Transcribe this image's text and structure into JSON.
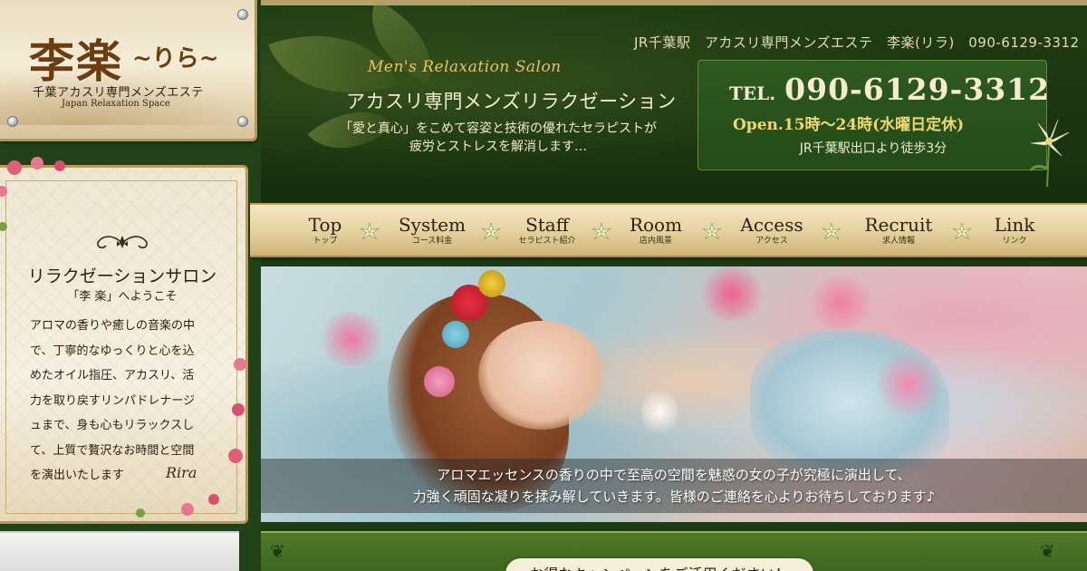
{
  "logo": {
    "main": "李楽",
    "sub": "~りら~",
    "tagline": "千葉アカスリ専門メンズエステ",
    "tagline_en": "Japan Relaxation Space"
  },
  "welcome": {
    "ornament_icon": "scroll-ornament-icon",
    "title": "リラクゼーションサロン",
    "subtitle": "「李 楽」へようこそ",
    "body": "アロマの香りや癒しの音楽の中\nで、丁寧的なゆっくりと心を込\nめたオイル指圧、アカスリ、活\n力を取り戻すリンパドレナージ\nュまで、身も心もリラックスし\nて、上質で贅沢なお時間と空間\nを演出いたします",
    "signature": "Rira"
  },
  "header": {
    "top_info": "JR千葉駅　アカスリ専門メンズエステ　李楽(リラ)　090-6129-3312",
    "script_title": "Men's Relaxation Salon",
    "title": "アカスリ専門メンズリラクゼーション",
    "description": "「愛と真心」をこめて容姿と技術の優れたセラピストが\n疲労とストレスを解消します…"
  },
  "tel_box": {
    "label": "TEL.",
    "number": "090-6129-3312",
    "open_hours": "Open.15時～24時(水曜日定休)",
    "access": "JR千葉駅出口より徒歩3分"
  },
  "nav": {
    "items": [
      {
        "en": "Top",
        "jp": "トップ"
      },
      {
        "en": "System",
        "jp": "コース料金"
      },
      {
        "en": "Staff",
        "jp": "セラピスト紹介"
      },
      {
        "en": "Room",
        "jp": "店内風景"
      },
      {
        "en": "Access",
        "jp": "アクセス"
      },
      {
        "en": "Recruit",
        "jp": "求人情報"
      },
      {
        "en": "Link",
        "jp": "リンク"
      }
    ],
    "separator_icon": "lily-flower-icon"
  },
  "hero": {
    "caption": "アロマエッセンスの香りの中で至高の空間を魅惑の女の子が究極に演出して、\n力強く頑固な凝りを揉み解していきます。皆様のご連絡を心よりお待ちしております♪"
  },
  "campaign": {
    "text": "お得なキャンペーンをご活用ください！"
  },
  "colors": {
    "dark_green": "#1d3a14",
    "header_green": "#203c14",
    "gold": "#b5a06a",
    "cream": "#f3e6c2",
    "accent_yellow": "#f0d870",
    "script_gold": "#e6c46a"
  }
}
